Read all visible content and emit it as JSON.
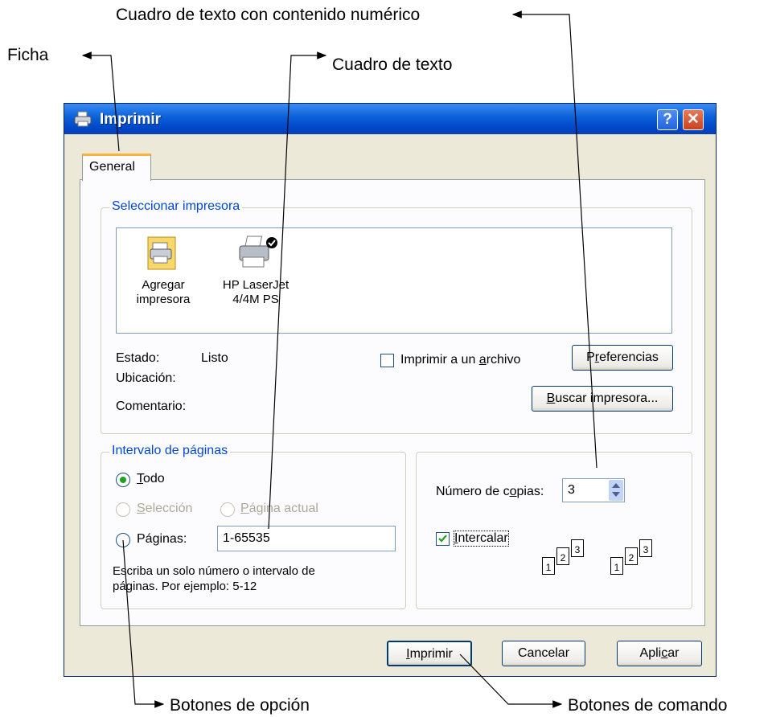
{
  "annotations": {
    "top": "Cuadro de texto con contenido numérico",
    "ficha": "Ficha",
    "cuadro_texto": "Cuadro de texto",
    "botones_opcion": "Botones de opción",
    "botones_comando": "Botones de comando"
  },
  "window": {
    "title": "Imprimir",
    "help": "?",
    "close": "✕"
  },
  "tab": {
    "label": "General"
  },
  "printer_group": {
    "legend": "Seleccionar impresora",
    "printers": [
      {
        "line1": "Agregar",
        "line2": "impresora",
        "icon": "add-printer-icon"
      },
      {
        "line1": "HP LaserJet",
        "line2": "4/4M PS",
        "icon": "printer-icon"
      }
    ],
    "estado_label": "Estado:",
    "estado_value": "Listo",
    "ubicacion_label": "Ubicación:",
    "comentario_label": "Comentario:",
    "print_to_file": {
      "pre": "Imprimir a un ",
      "u": "a",
      "post": "rchivo",
      "checked": false
    },
    "preferencias": {
      "pre": "P",
      "u": "r",
      "post": "eferencias"
    },
    "buscar": {
      "pre": "",
      "u": "B",
      "post": "uscar impresora..."
    }
  },
  "range_group": {
    "legend": "Intervalo de páginas",
    "todo": {
      "u": "T",
      "post": "odo",
      "selected": true
    },
    "seleccion": {
      "u": "S",
      "post": "elección",
      "disabled": true
    },
    "pagina_actual": {
      "u": "P",
      "post": "ágina actual",
      "disabled": true
    },
    "paginas": {
      "label": "Páginas:",
      "value": "1-65535"
    },
    "hint_line1": "Escriba un solo número o intervalo de",
    "hint_line2": "páginas. Por ejemplo: 5-12"
  },
  "copies_group": {
    "copies_label": {
      "pre": "Número de c",
      "u": "o",
      "post": "pias:"
    },
    "copies_value": "3",
    "intercalar": {
      "u": "I",
      "post": "ntercalar",
      "checked": true
    },
    "collate_numbers": [
      "1",
      "2",
      "3"
    ]
  },
  "buttons": {
    "imprimir": {
      "pre": "",
      "u": "I",
      "post": "mprimir"
    },
    "cancelar": "Cancelar",
    "aplicar": {
      "pre": "Apli",
      "u": "c",
      "post": "ar"
    }
  },
  "colors": {
    "legend": "#0046d5",
    "title_bar": "#0058e6",
    "dialog_bg": "#ece9d8"
  }
}
